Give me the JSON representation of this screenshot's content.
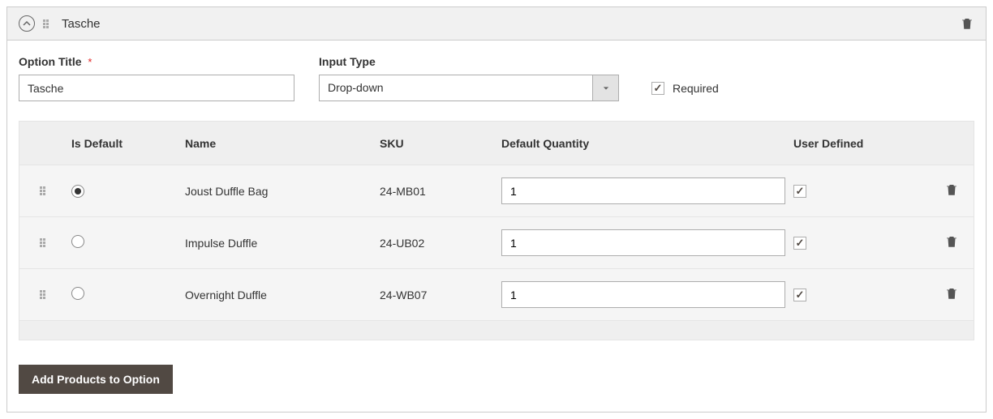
{
  "option": {
    "header_title": "Tasche",
    "option_title_label": "Option Title",
    "option_title_value": "Tasche",
    "input_type_label": "Input Type",
    "input_type_value": "Drop-down",
    "required_label": "Required",
    "required_checked": true
  },
  "grid": {
    "headers": {
      "is_default": "Is Default",
      "name": "Name",
      "sku": "SKU",
      "default_qty": "Default Quantity",
      "user_defined": "User Defined"
    },
    "rows": [
      {
        "is_default": true,
        "name": "Joust Duffle Bag",
        "sku": "24-MB01",
        "qty": "1",
        "user_defined": true
      },
      {
        "is_default": false,
        "name": "Impulse Duffle",
        "sku": "24-UB02",
        "qty": "1",
        "user_defined": true
      },
      {
        "is_default": false,
        "name": "Overnight Duffle",
        "sku": "24-WB07",
        "qty": "1",
        "user_defined": true
      }
    ]
  },
  "buttons": {
    "add_products": "Add Products to Option"
  }
}
